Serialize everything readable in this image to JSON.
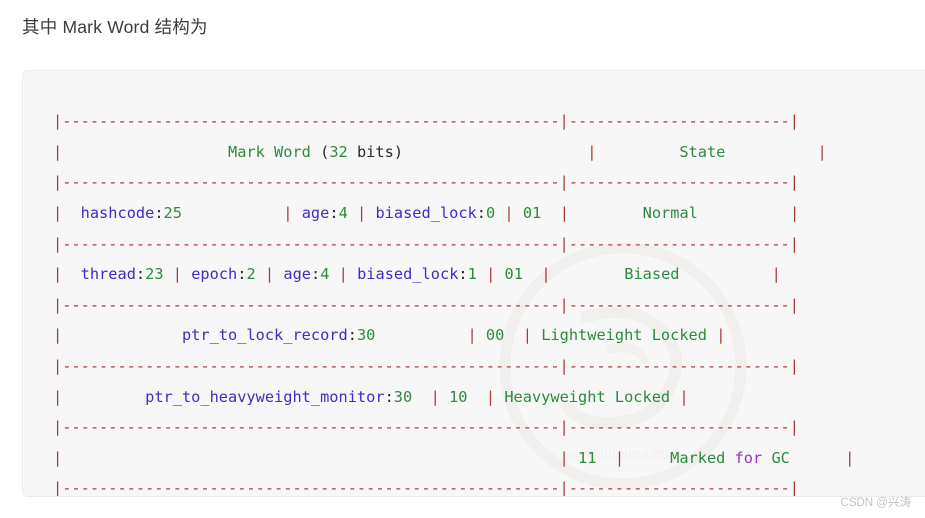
{
  "page": {
    "heading": "其中 Mark Word 结构为",
    "attribution": "CSDN @兴涛"
  },
  "code_block": {
    "language": "plaintext",
    "columns": [
      "Mark Word (32 bits)",
      "State"
    ],
    "separator_markword": "|------------------------------------------------------|",
    "separator_state": "------------------------|",
    "rows": [
      {
        "kind": "header",
        "markword_title_prefix": "Mark Word ",
        "markword_title_paren_open": "(",
        "markword_title_bits": "32",
        "markword_title_unit": " bits",
        "markword_title_paren_close": ")",
        "state": "State"
      },
      {
        "kind": "data",
        "fields": [
          {
            "name": "hashcode",
            "bits": "25"
          },
          {
            "name": "age",
            "bits": "4"
          },
          {
            "name": "biased_lock",
            "bits": "0"
          }
        ],
        "tag": "01",
        "state": "Normal"
      },
      {
        "kind": "data",
        "fields": [
          {
            "name": "thread",
            "bits": "23"
          },
          {
            "name": "epoch",
            "bits": "2"
          },
          {
            "name": "age",
            "bits": "4"
          },
          {
            "name": "biased_lock",
            "bits": "1"
          }
        ],
        "tag": "01",
        "state": "Biased"
      },
      {
        "kind": "data",
        "fields": [
          {
            "name": "ptr_to_lock_record",
            "bits": "30"
          }
        ],
        "tag": "00",
        "state": "Lightweight Locked"
      },
      {
        "kind": "data",
        "fields": [
          {
            "name": "ptr_to_heavyweight_monitor",
            "bits": "30"
          }
        ],
        "tag": "10",
        "state": "Heavyweight Locked"
      },
      {
        "kind": "data",
        "fields": [],
        "tag": "11",
        "state_word_1": "Marked",
        "state_keyword": "for",
        "state_word_2": "GC"
      }
    ]
  }
}
